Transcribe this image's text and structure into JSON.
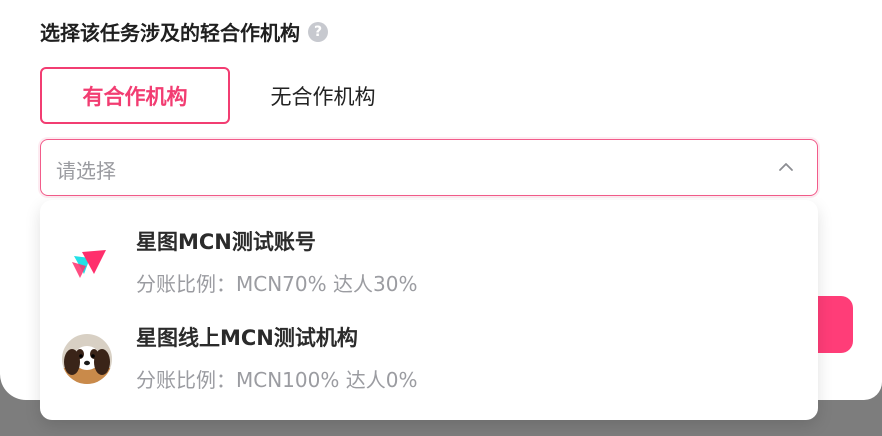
{
  "section": {
    "title": "选择该任务涉及的轻合作机构",
    "help_icon": "?"
  },
  "cooperation_toggle": {
    "selected_label": "有合作机构",
    "other_label": "无合作机构"
  },
  "agency_select": {
    "placeholder": "请选择"
  },
  "options": [
    {
      "name": "星图MCN测试账号",
      "ratio": "分账比例：MCN70% 达人30%",
      "avatar_icon": "mcn-logo-icon"
    },
    {
      "name": "星图线上MCN测试机构",
      "ratio": "分账比例：MCN100% 达人0%",
      "avatar_icon": "dog-avatar-icon"
    }
  ],
  "colors": {
    "accent": "#f23d72",
    "accent_button": "#ff3d78"
  }
}
